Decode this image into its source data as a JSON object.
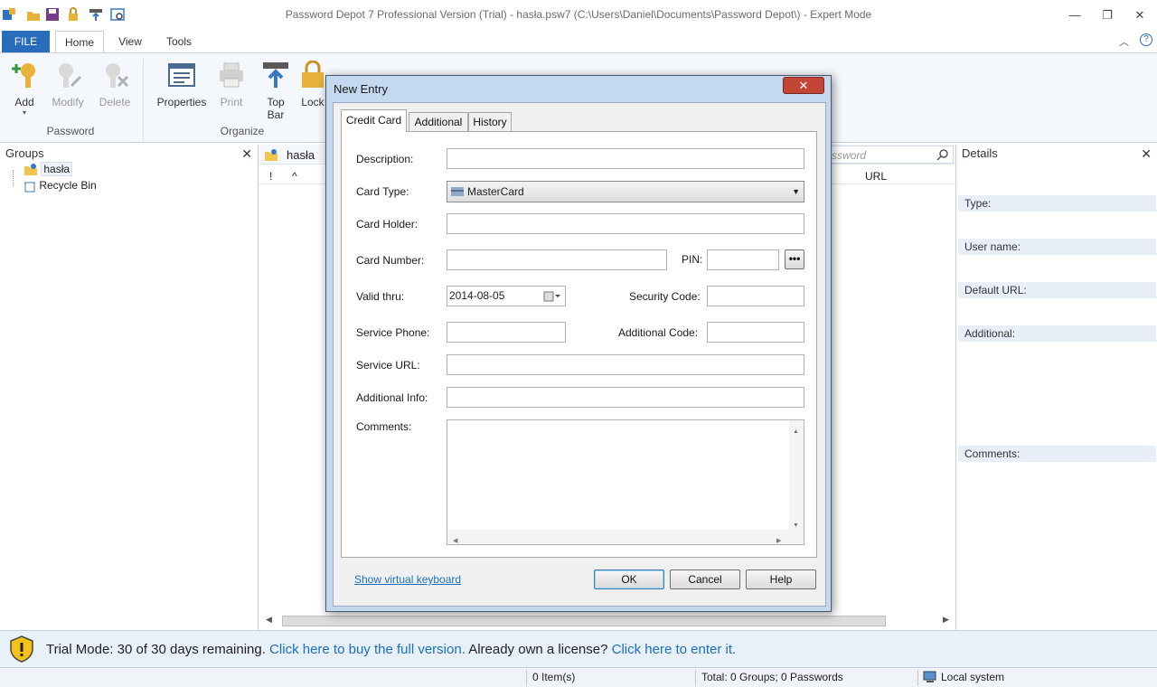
{
  "window": {
    "title": "Password Depot 7 Professional Version (Trial) - hasła.psw7 (C:\\Users\\Daniel\\Documents\\Password Depot\\) - Expert Mode",
    "minimize": "—",
    "maximize": "❐",
    "close": "✕"
  },
  "ribbon": {
    "tabs": [
      "FILE",
      "Home",
      "View",
      "Tools"
    ],
    "active_tab": "Home",
    "buttons": {
      "add": "Add",
      "modify": "Modify",
      "delete": "Delete",
      "properties": "Properties",
      "print": "Print",
      "top_bar_1": "Top",
      "top_bar_2": "Bar",
      "lock": "Lock"
    },
    "groups": {
      "password": "Password",
      "organize": "Organize"
    }
  },
  "groups_panel": {
    "title": "Groups",
    "items": [
      "hasła",
      "Recycle Bin"
    ]
  },
  "list_panel": {
    "tab_label": "hasła",
    "search_placeholder": "ssword",
    "columns": [
      "!",
      "^",
      "URL"
    ]
  },
  "details_panel": {
    "title": "Details",
    "labels": [
      "Type:",
      "User name:",
      "Default URL:",
      "Additional:",
      "Comments:"
    ]
  },
  "dialog": {
    "title": "New Entry",
    "tabs": [
      "Credit Card",
      "Additional",
      "History"
    ],
    "active_tab": "Credit Card",
    "labels": {
      "description": "Description:",
      "card_type": "Card Type:",
      "card_holder": "Card Holder:",
      "card_number": "Card Number:",
      "pin": "PIN:",
      "valid_thru": "Valid thru:",
      "security_code": "Security Code:",
      "service_phone": "Service Phone:",
      "additional_code": "Additional Code:",
      "service_url": "Service URL:",
      "additional_info": "Additional Info:",
      "comments": "Comments:"
    },
    "values": {
      "description": "",
      "card_type": "MasterCard",
      "card_holder": "",
      "card_number": "",
      "pin": "",
      "valid_thru": "2014-08-05",
      "security_code": "",
      "service_phone": "",
      "additional_code": "",
      "service_url": "",
      "additional_info": "",
      "comments": ""
    },
    "pin_button": "•••",
    "virtual_keyboard_link": "Show virtual keyboard",
    "ok": "OK",
    "cancel": "Cancel",
    "help": "Help"
  },
  "trial_bar": {
    "text": "Trial Mode: 30 of 30 days remaining. ",
    "buy_link": "Click here to buy the full version.",
    "license_text": " Already own a license? ",
    "enter_link": "Click here to enter it."
  },
  "status_bar": {
    "items_count": "0 Item(s)",
    "totals": "Total: 0 Groups; 0 Passwords",
    "location": "Local system"
  },
  "colors": {
    "accent": "#2a6cbc",
    "link": "#1d6ebc",
    "dialog_frame": "#c4d9ef",
    "close_red": "#c24535"
  }
}
